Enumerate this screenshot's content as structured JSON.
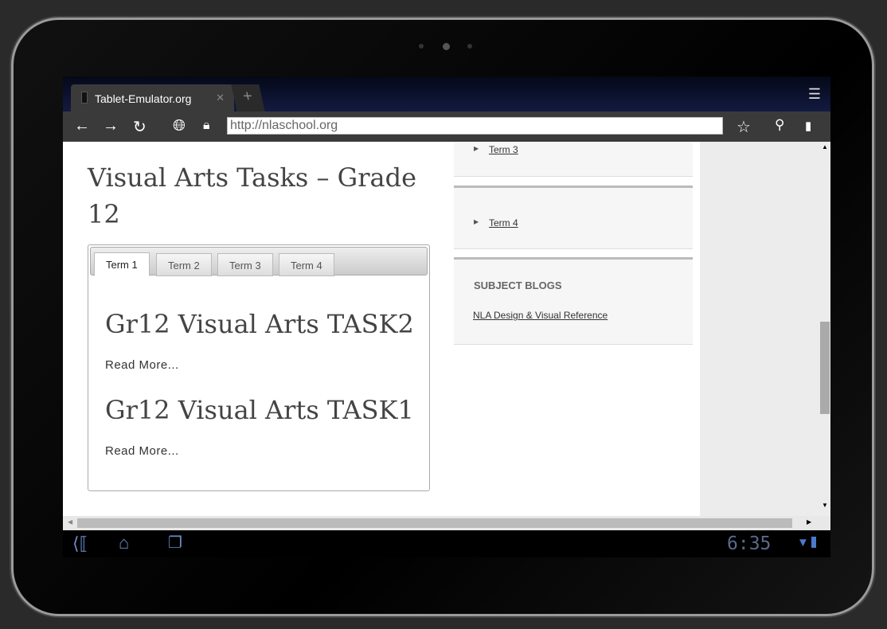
{
  "browser": {
    "tab_title": "Tablet-Emulator.org",
    "url": "http://nlaschool.org"
  },
  "page": {
    "title": "Visual Arts Tasks – Grade 12",
    "tabs": [
      "Term 1",
      "Term 2",
      "Term 3",
      "Term 4"
    ],
    "posts": [
      {
        "title": "Gr12 Visual Arts TASK2",
        "read_more": "Read More..."
      },
      {
        "title": "Gr12 Visual Arts TASK1",
        "read_more": "Read More..."
      }
    ]
  },
  "sidebar": {
    "links": [
      "Term 3",
      "Term 4"
    ],
    "blogs_heading": "SUBJECT BLOGS",
    "blog_link": "NLA Design & Visual Reference"
  },
  "statusbar": {
    "time": "6:35"
  }
}
